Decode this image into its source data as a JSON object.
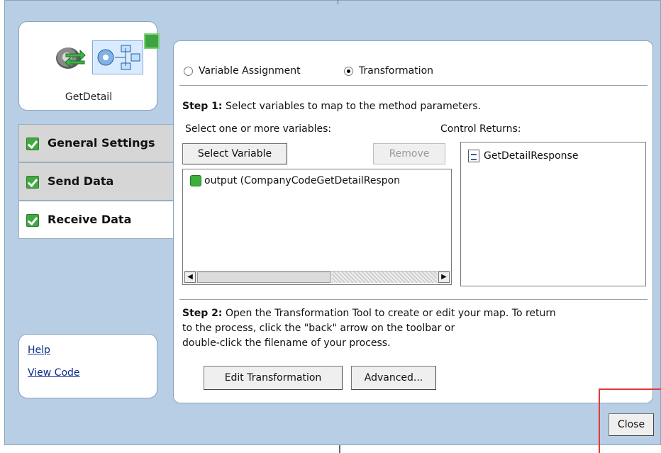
{
  "node": {
    "name": "GetDetail"
  },
  "tabs": [
    {
      "label": "General Settings"
    },
    {
      "label": "Send Data"
    },
    {
      "label": "Receive Data"
    }
  ],
  "links": {
    "help": "Help",
    "view_code": "View Code"
  },
  "mode": {
    "variable_assignment": "Variable Assignment",
    "transformation": "Transformation",
    "selected": "Transformation"
  },
  "step1": {
    "title": "Step 1:",
    "text": "Select variables to map to the method parameters.",
    "select_label": "Select one or more variables:",
    "control_returns_label": "Control Returns:",
    "select_button": "Select Variable",
    "remove_button": "Remove",
    "variables": [
      "output (CompanyCodeGetDetailRespon"
    ],
    "returns": [
      "GetDetailResponse"
    ]
  },
  "step2": {
    "title": "Step 2:",
    "line1": "Open the Transformation Tool to create or edit your map. To return",
    "line2": "to the process, click the \"back\" arrow on the toolbar or",
    "line3": "double-click the filename of your process.",
    "edit_button": "Edit Transformation",
    "advanced_button": "Advanced..."
  },
  "footer": {
    "close_button": "Close"
  },
  "colors": {
    "frame": "#b8cee4",
    "highlight": "#e03a3a",
    "check": "#43a843"
  }
}
